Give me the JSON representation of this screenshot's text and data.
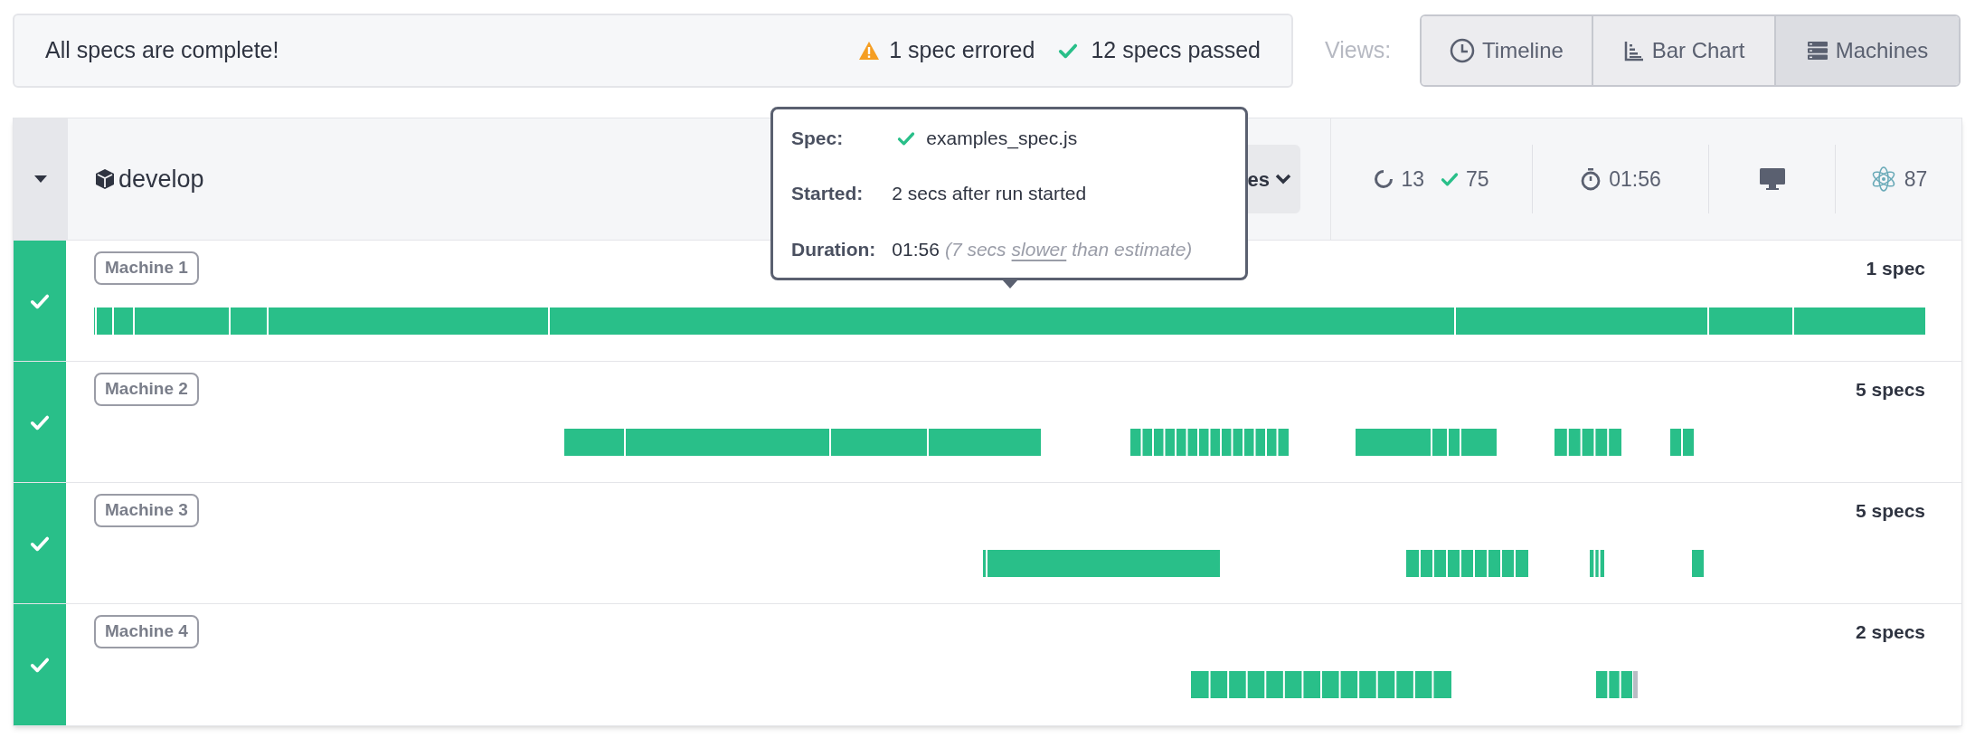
{
  "status_bar": {
    "message": "All specs are complete!",
    "errored": "1 spec errored",
    "passed": "12 specs passed"
  },
  "views": {
    "label": "Views:",
    "options": [
      {
        "label": "Timeline",
        "selected": false
      },
      {
        "label": "Bar Chart",
        "selected": false
      },
      {
        "label": "Machines",
        "selected": true
      }
    ]
  },
  "run": {
    "expanded": true,
    "branch": "develop",
    "machines_button": "es",
    "pending": "13",
    "passed": "75",
    "duration": "01:56",
    "browser_count": "87"
  },
  "machines": [
    {
      "name": "Machine 1",
      "passed": true,
      "spec_count": "1 spec"
    },
    {
      "name": "Machine 2",
      "passed": true,
      "spec_count": "5 specs"
    },
    {
      "name": "Machine 3",
      "passed": true,
      "spec_count": "5 specs"
    },
    {
      "name": "Machine 4",
      "passed": true,
      "spec_count": "2 specs"
    }
  ],
  "tooltip": {
    "spec_label": "Spec:",
    "spec": "examples_spec.js",
    "started_label": "Started:",
    "started": "2 secs after run started",
    "duration_label": "Duration:",
    "duration": "01:56",
    "note_before": "(7 secs",
    "note_link": "slower",
    "note_after": "than estimate)"
  }
}
